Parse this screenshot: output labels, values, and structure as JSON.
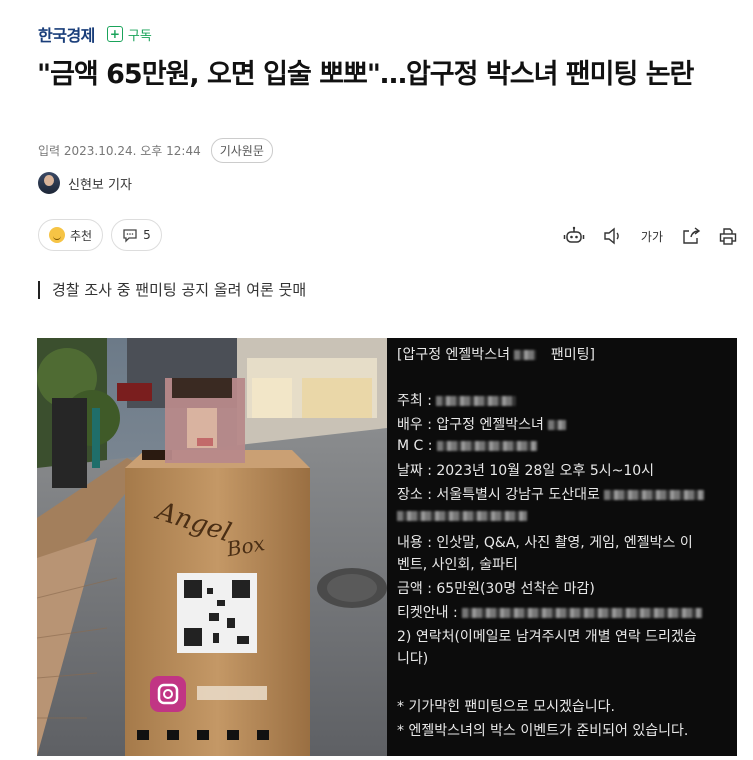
{
  "header": {
    "brand": "한국경제",
    "subscribe_icon": "plus-icon",
    "subscribe_label": "구독"
  },
  "article": {
    "title": "\"금액 65만원, 오면 입술 뽀뽀\"…압구정 박스녀 팬미팅 논란",
    "published": "입력 2023.10.24. 오후 12:44",
    "original_button": "기사원문",
    "author": "신현보 기자",
    "subtitle": "경찰 조사 중 팬미팅 공지 올려 여론 뭇매"
  },
  "actions": {
    "recommend_label": "추천",
    "comments_count": "5"
  },
  "tools": {
    "font_size_label": "가가",
    "icons": [
      "robot-icon",
      "speaker-icon",
      "font-size-icon",
      "share-icon",
      "print-icon"
    ]
  },
  "photo": {
    "box_text_1": "Angel",
    "box_text_2": "Box",
    "notice_lines": [
      "[압구정 엔젤박스녀",
      "팬미팅]",
      "주최 :",
      "배우 : 압구정 엔젤박스녀",
      "M C :",
      "날짜 : 2023년 10월 28일 오후 5시~10시",
      "장소 : 서울특별시 강남구 도산대로",
      "내용 : 인삿말, Q&A, 사진 촬영, 게임, 엔젤박스 이",
      "벤트, 사인회, 술파티",
      "금액 : 65만원(30명 선착순 마감)",
      "티켓안내 :",
      "2) 연락처(이메일로 남겨주시면 개별 연락 드리겠습",
      "니다)",
      "* 기가막힌 팬미팅으로 모시겠습니다.",
      "* 엔젤박스녀의 박스 이벤트가 준비되어 있습니다."
    ]
  },
  "colors": {
    "brand": "#1a3e7a",
    "subscribe": "#1aa35a"
  }
}
